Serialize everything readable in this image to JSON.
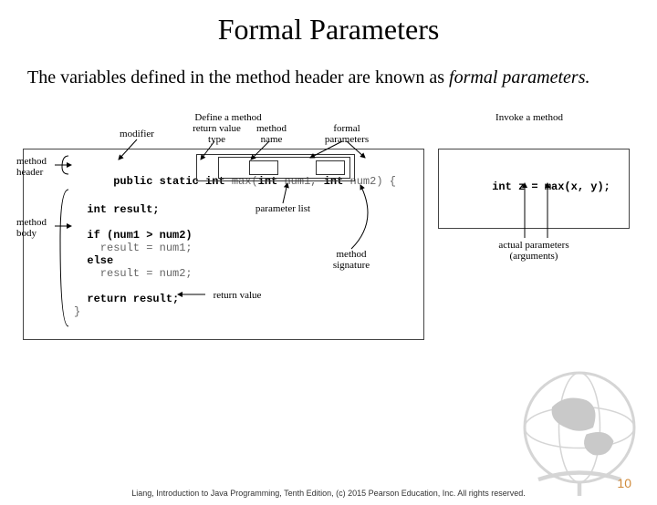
{
  "title": "Formal Parameters",
  "description_plain": "The variables defined in the method header are known as ",
  "description_italic": "formal parameters.",
  "top_labels": {
    "define": "Define a method",
    "invoke": "Invoke a method",
    "modifier": "modifier",
    "return_type": "return value\ntype",
    "method_name": "method\nname",
    "formal_params": "formal\nparameters"
  },
  "side_labels": {
    "method_header": "method\nheader",
    "method_body": "method\nbody"
  },
  "below_labels": {
    "parameter_list": "parameter list",
    "method_signature": "method\nsignature",
    "return_value": "return value",
    "actual_params": "actual parameters\n(arguments)"
  },
  "code": {
    "sig_prefix": "public static int ",
    "sig_name": "max",
    "sig_open": "(",
    "sig_p1a": "int ",
    "sig_p1b": "num1",
    "sig_sep": ", ",
    "sig_p2a": "int ",
    "sig_p2b": "num2",
    "sig_close": ") {",
    "body1": "  int result;",
    "body2": "  if (num1 > num2)",
    "body3": "    result = num1;",
    "body4": "  else",
    "body5": "    result = num2;",
    "body6": "  return result;",
    "body7": "}",
    "invoke": "int z = max(x, y);"
  },
  "footer": "Liang, Introduction to Java Programming, Tenth Edition, (c) 2015 Pearson Education, Inc. All rights reserved.",
  "page": "10"
}
